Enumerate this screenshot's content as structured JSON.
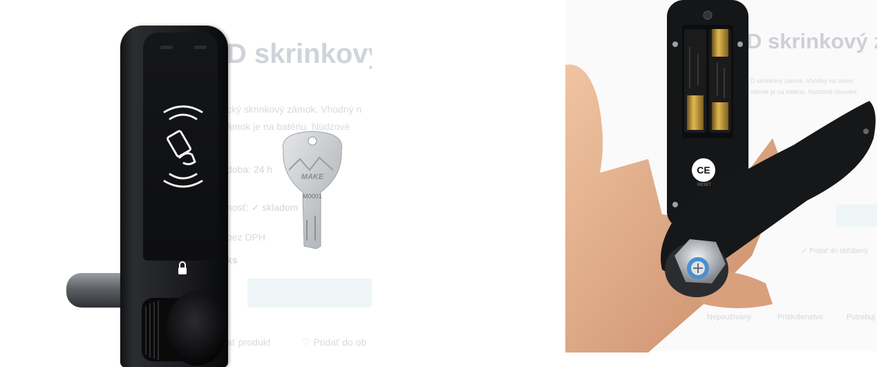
{
  "left_panel": {
    "ghost_page": {
      "title": "D skrinkový",
      "description_line1": "cký skrinkový zámok. Vhodný n",
      "description_line2": "ámok je na batériu. Núdzové",
      "delivery": "doba: 24 h",
      "availability": "nosť: ✓ skladom",
      "vat": "bez DPH",
      "pieces": "ks",
      "rate_product": "ať produkt",
      "wishlist": "♡ Pridať do ob"
    },
    "key": {
      "engraving": "MAKE",
      "code": "M0001"
    }
  },
  "right_panel": {
    "ghost_page": {
      "title": "D skrinkový zá",
      "description_line1": "D skrinkový zámok. Vhodný na dreve",
      "description_line2": "zámok je na batériu. Núdzové otvoreni",
      "compare": "✓ Pridať do obľúbený",
      "tab1": "Nepoužívaný",
      "tab2": "Príslušenstvo",
      "tab3": "Potrebuj"
    },
    "device": {
      "certification": "CE",
      "reset_label": "RESET"
    }
  },
  "colors": {
    "lock_black": "#111214",
    "face_black": "#0d0e10",
    "rfid_white": "#f2f2f2",
    "key_silver": "#c8cacc",
    "battery_gold": "#c99a2e",
    "skin": "#e2b08e"
  },
  "icons": [
    "rfid-card-icon",
    "padlock-icon",
    "ce-mark-icon"
  ]
}
